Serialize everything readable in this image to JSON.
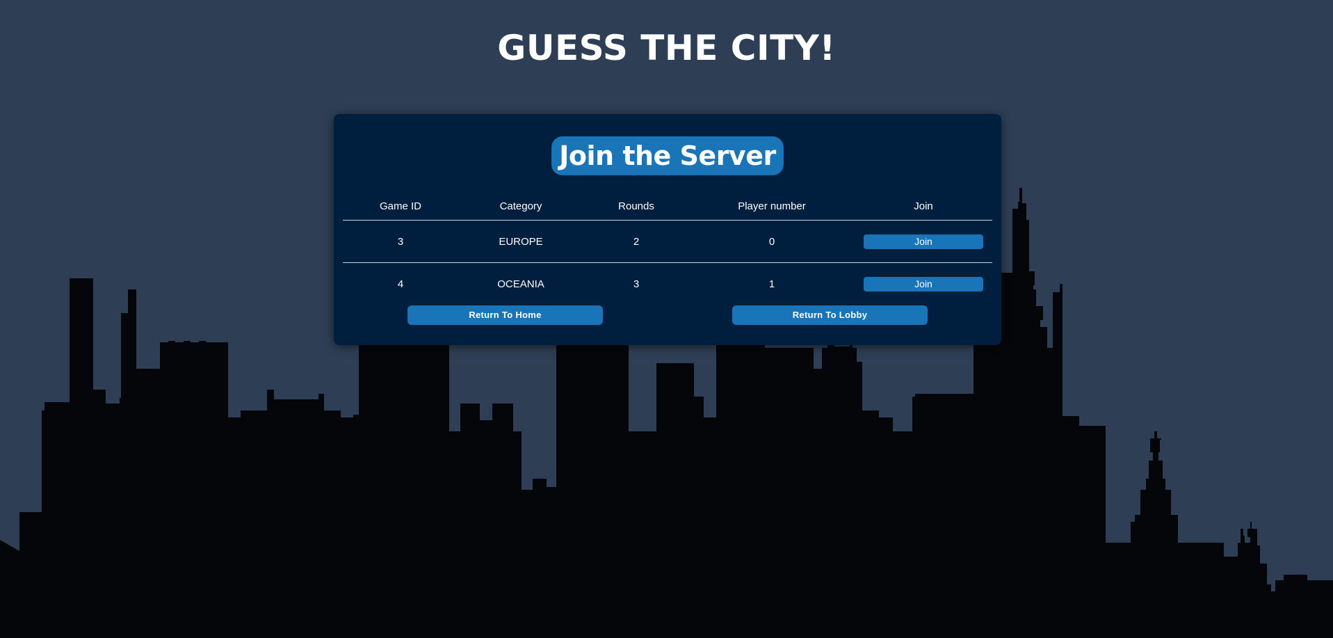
{
  "page": {
    "title": "GUESS THE CITY!",
    "colors": {
      "background": "#2e3f55",
      "panel": "#001f3f",
      "accent": "#1a75b8",
      "skyline": "#040609"
    }
  },
  "panel": {
    "header": "Join the Server",
    "table": {
      "headers": [
        "Game ID",
        "Category",
        "Rounds",
        "Player number",
        "Join"
      ],
      "rows": [
        {
          "game_id": "3",
          "category": "EUROPE",
          "rounds": "2",
          "players": "0",
          "join_label": "Join"
        },
        {
          "game_id": "4",
          "category": "OCEANIA",
          "rounds": "3",
          "players": "1",
          "join_label": "Join"
        }
      ]
    },
    "buttons": {
      "home": "Return To Home",
      "lobby": "Return To Lobby"
    }
  }
}
